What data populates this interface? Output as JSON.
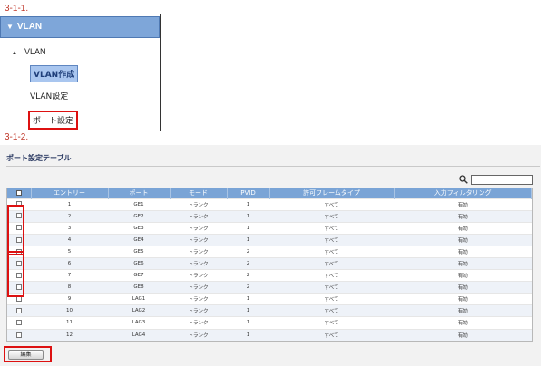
{
  "steps": {
    "step1": "3-1-1.",
    "step2": "3-1-2."
  },
  "menu": {
    "header": "VLAN",
    "group": "VLAN",
    "items": [
      {
        "label": "VLAN作成",
        "selected": true
      },
      {
        "label": "VLAN設定",
        "selected": false
      },
      {
        "label": "ポート設定",
        "selected": false,
        "highlighted": true
      }
    ]
  },
  "port_table": {
    "title": "ポート設定テーブル",
    "search": {
      "value": "",
      "icon": "search-icon"
    },
    "columns": [
      "",
      "エントリー",
      "ポート",
      "モード",
      "PVID",
      "許可フレームタイプ",
      "入力フィルタリング"
    ],
    "rows": [
      {
        "entry": "1",
        "port": "GE1",
        "mode": "トランク",
        "pvid": "1",
        "frame_type": "すべて",
        "filtering": "有効"
      },
      {
        "entry": "2",
        "port": "GE2",
        "mode": "トランク",
        "pvid": "1",
        "frame_type": "すべて",
        "filtering": "有効"
      },
      {
        "entry": "3",
        "port": "GE3",
        "mode": "トランク",
        "pvid": "1",
        "frame_type": "すべて",
        "filtering": "有効"
      },
      {
        "entry": "4",
        "port": "GE4",
        "mode": "トランク",
        "pvid": "1",
        "frame_type": "すべて",
        "filtering": "有効"
      },
      {
        "entry": "5",
        "port": "GE5",
        "mode": "トランク",
        "pvid": "2",
        "frame_type": "すべて",
        "filtering": "有効"
      },
      {
        "entry": "6",
        "port": "GE6",
        "mode": "トランク",
        "pvid": "2",
        "frame_type": "すべて",
        "filtering": "有効"
      },
      {
        "entry": "7",
        "port": "GE7",
        "mode": "トランク",
        "pvid": "2",
        "frame_type": "すべて",
        "filtering": "有効"
      },
      {
        "entry": "8",
        "port": "GE8",
        "mode": "トランク",
        "pvid": "2",
        "frame_type": "すべて",
        "filtering": "有効"
      },
      {
        "entry": "9",
        "port": "LAG1",
        "mode": "トランク",
        "pvid": "1",
        "frame_type": "すべて",
        "filtering": "有効"
      },
      {
        "entry": "10",
        "port": "LAG2",
        "mode": "トランク",
        "pvid": "1",
        "frame_type": "すべて",
        "filtering": "有効"
      },
      {
        "entry": "11",
        "port": "LAG3",
        "mode": "トランク",
        "pvid": "1",
        "frame_type": "すべて",
        "filtering": "有効"
      },
      {
        "entry": "12",
        "port": "LAG4",
        "mode": "トランク",
        "pvid": "1",
        "frame_type": "すべて",
        "filtering": "有効"
      }
    ],
    "edit_button": "編集"
  },
  "colors": {
    "header_blue": "#7aa4d6",
    "highlight_red": "#dd1111",
    "menu_header": "#7ea6d9"
  }
}
